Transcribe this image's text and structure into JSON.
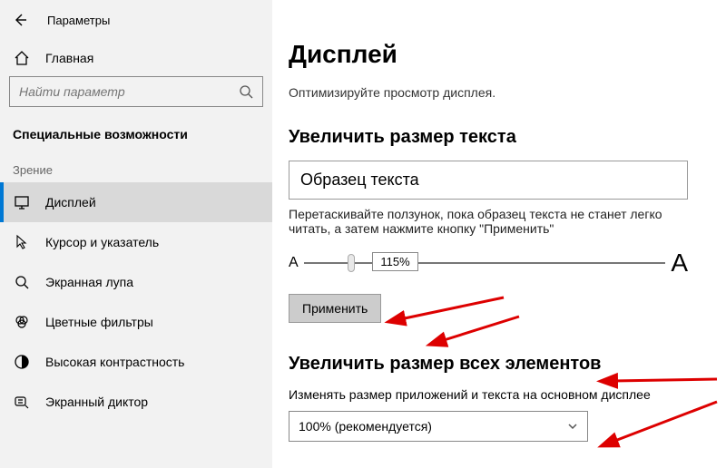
{
  "app": {
    "title": "Параметры"
  },
  "sidebar": {
    "home_label": "Главная",
    "search_placeholder": "Найти параметр",
    "section_title": "Специальные возможности",
    "group_label": "Зрение",
    "items": [
      {
        "label": "Дисплей"
      },
      {
        "label": "Курсор и указатель"
      },
      {
        "label": "Экранная лупа"
      },
      {
        "label": "Цветные фильтры"
      },
      {
        "label": "Высокая контрастность"
      },
      {
        "label": "Экранный диктор"
      }
    ]
  },
  "page": {
    "title": "Дисплей",
    "subtitle": "Оптимизируйте просмотр дисплея.",
    "text_size": {
      "heading": "Увеличить размер текста",
      "sample": "Образец текста",
      "hint": "Перетаскивайте ползунок, пока образец текста не станет легко читать, а затем нажмите кнопку \"Применить\"",
      "a_small": "A",
      "a_big": "A",
      "value": "115%",
      "apply": "Применить"
    },
    "scale": {
      "heading": "Увеличить размер всех элементов",
      "label": "Изменять размер приложений и текста на основном дисплее",
      "selected": "100% (рекомендуется)"
    }
  }
}
